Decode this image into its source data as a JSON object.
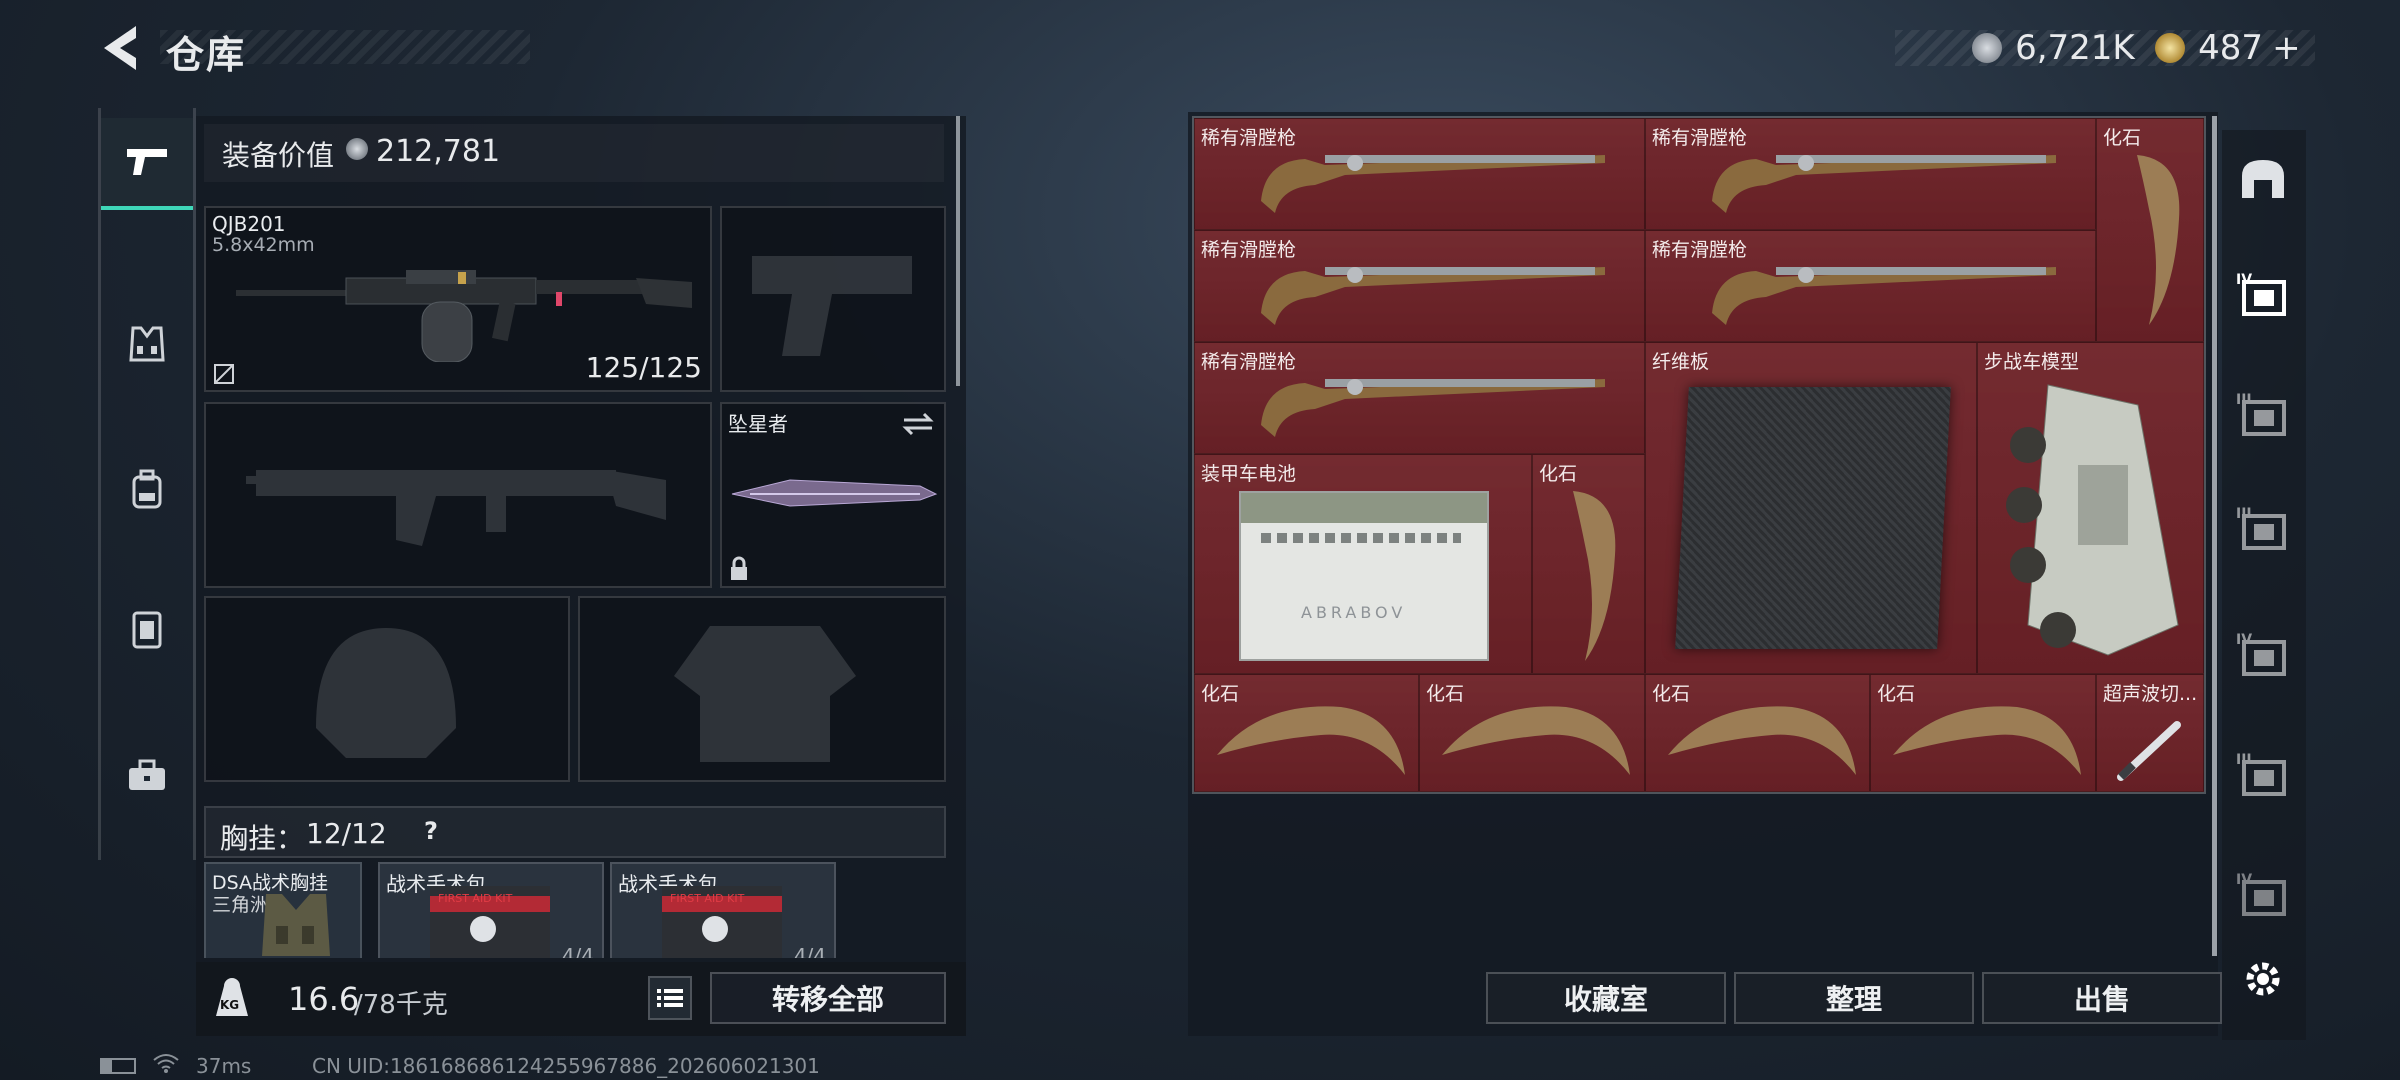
{
  "header": {
    "title": "仓库",
    "currency_primary": "6,721K",
    "currency_secondary": "487",
    "currency_add": "+"
  },
  "rail": [
    {
      "icon": "pistol-icon",
      "active": true
    },
    {
      "icon": "vest-icon"
    },
    {
      "icon": "backpack-icon"
    },
    {
      "icon": "armor-plate-icon"
    },
    {
      "icon": "toolbox-icon"
    }
  ],
  "loadout": {
    "value_label": "装备价值",
    "value": "212,781",
    "primary": {
      "name": "QJB201",
      "caliber": "5.8x42mm",
      "ammo": "125/125"
    },
    "melee": {
      "name": "坠星者"
    },
    "chest_rig_label": "胸挂：",
    "chest_rig_count": "12/12",
    "help": "?",
    "rig_items": [
      {
        "name": "DSA战术胸挂",
        "sub": "三角洲"
      },
      {
        "name": "战术手术包",
        "count": "4/4"
      },
      {
        "name": "战术手术包",
        "count": "4/4"
      }
    ],
    "kit_text": "FIRST AID KIT",
    "weight": "16.6",
    "weight_max": "/78千克",
    "kg_badge": "KG",
    "transfer_all": "转移全部"
  },
  "storage": {
    "items": [
      {
        "label": "稀有滑膛枪",
        "art": "musket"
      },
      {
        "label": "稀有滑膛枪",
        "art": "musket"
      },
      {
        "label": "化石",
        "art": "fossil-v"
      },
      {
        "label": "稀有滑膛枪",
        "art": "musket"
      },
      {
        "label": "稀有滑膛枪",
        "art": "musket"
      },
      {
        "label": "稀有滑膛枪",
        "art": "musket"
      },
      {
        "label": "纤维板",
        "art": "board"
      },
      {
        "label": "步战车模型",
        "art": "ifv"
      },
      {
        "label": "装甲车电池",
        "art": "battery"
      },
      {
        "label": "化石",
        "art": "fossil-v"
      },
      {
        "label": "化石",
        "art": "fossil-h"
      },
      {
        "label": "化石",
        "art": "fossil-h"
      },
      {
        "label": "化石",
        "art": "fossil-h"
      },
      {
        "label": "化石",
        "art": "fossil-h"
      },
      {
        "label": "超声波切...",
        "art": "cutter"
      }
    ],
    "battery_text": "ABRABOV",
    "buttons": {
      "collection": "收藏室",
      "sort": "整理",
      "sell": "出售"
    }
  },
  "side_tabs": [
    "bunker-icon",
    "tier-4-case-icon",
    "tier-3-case-icon",
    "tier-3-case-icon",
    "tier-4-case-icon",
    "tier-3-case-icon",
    "tier-4-case-icon",
    "gear-icon"
  ],
  "status": {
    "ping": "37ms",
    "uid": "CN UID:18616868612425596788​6_202606021301"
  },
  "colors": {
    "accent": "#3fd7b9",
    "item_bg": "#6e2228"
  }
}
